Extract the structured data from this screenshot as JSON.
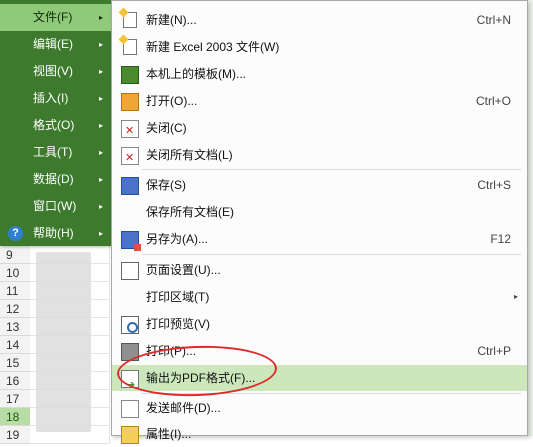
{
  "main_menu": {
    "items": [
      {
        "label": "文件(F)",
        "active": true
      },
      {
        "label": "编辑(E)"
      },
      {
        "label": "视图(V)"
      },
      {
        "label": "插入(I)"
      },
      {
        "label": "格式(O)"
      },
      {
        "label": "工具(T)"
      },
      {
        "label": "数据(D)"
      },
      {
        "label": "窗口(W)"
      },
      {
        "label": "帮助(H)",
        "icon": "help-icon"
      }
    ],
    "arrow": "▸"
  },
  "sub_menu": {
    "items": [
      {
        "label": "新建(N)...",
        "shortcut": "Ctrl+N",
        "icon": "new-document-icon"
      },
      {
        "label": "新建 Excel 2003 文件(W)",
        "shortcut": "",
        "icon": "new-excel-icon"
      },
      {
        "label": "本机上的模板(M)...",
        "shortcut": "",
        "icon": "template-icon"
      },
      {
        "label": "打开(O)...",
        "shortcut": "Ctrl+O",
        "icon": "open-folder-icon"
      },
      {
        "label": "关闭(C)",
        "shortcut": "",
        "icon": "close-icon"
      },
      {
        "label": "关闭所有文档(L)",
        "shortcut": "",
        "icon": "close-all-icon"
      },
      {
        "label": "保存(S)",
        "shortcut": "Ctrl+S",
        "icon": "save-icon"
      },
      {
        "label": "保存所有文档(E)",
        "shortcut": "",
        "icon": ""
      },
      {
        "label": "另存为(A)...",
        "shortcut": "F12",
        "icon": "save-as-icon"
      },
      {
        "label": "页面设置(U)...",
        "shortcut": "",
        "icon": "page-setup-icon"
      },
      {
        "label": "打印区域(T)",
        "shortcut": "",
        "icon": "",
        "submenu": true
      },
      {
        "label": "打印预览(V)",
        "shortcut": "",
        "icon": "print-preview-icon"
      },
      {
        "label": "打印(P)...",
        "shortcut": "Ctrl+P",
        "icon": "print-icon"
      },
      {
        "label": "输出为PDF格式(F)...",
        "shortcut": "",
        "icon": "export-pdf-icon",
        "highlighted": true
      },
      {
        "label": "发送邮件(D)...",
        "shortcut": "",
        "icon": "mail-icon"
      },
      {
        "label": "属性(I)...",
        "shortcut": "",
        "icon": "properties-icon"
      }
    ],
    "sub_arrow": "▸"
  },
  "sheet": {
    "row_numbers": [
      "9",
      "10",
      "11",
      "12",
      "13",
      "14",
      "15",
      "16",
      "17",
      "18",
      "19"
    ],
    "selected_row": "18"
  },
  "colors": {
    "menu_bg": "#3d7a2e",
    "menu_active": "#90c97a",
    "highlight": "#cde7bd",
    "annotation": "#e02a2a"
  }
}
